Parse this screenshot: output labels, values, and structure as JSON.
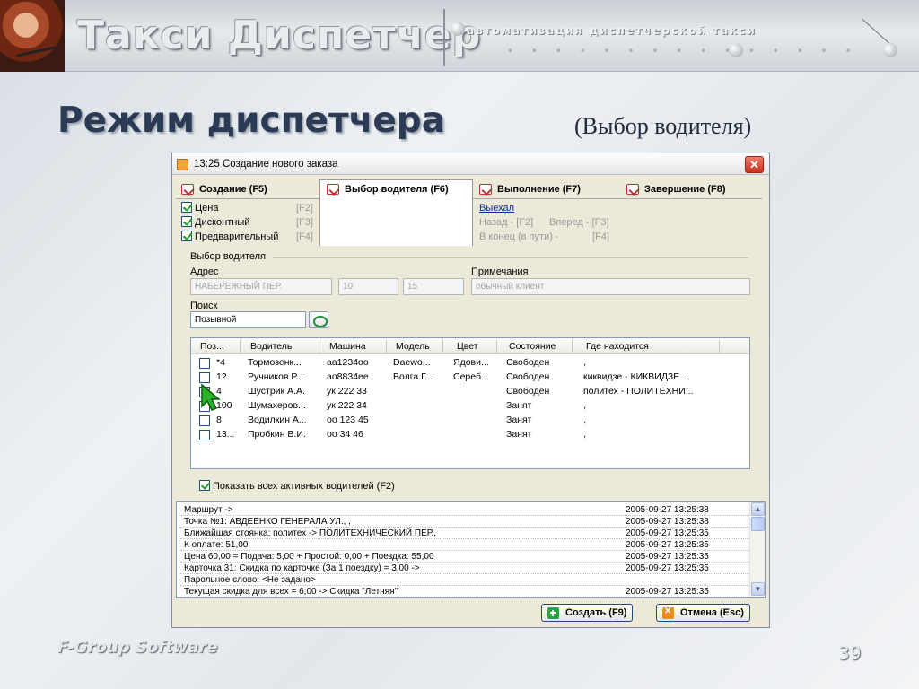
{
  "banner": {
    "title": "Такси Диспетчер",
    "subtitle": "автоматизация диспетчерской такси"
  },
  "slide": {
    "heading": "Режим диспетчера",
    "subheading": "(Выбор водителя)",
    "footer_company": "F-Group Software",
    "page_number": "39"
  },
  "window": {
    "title": "13:25 Создание нового заказа",
    "close_label": "✕",
    "tabs": [
      {
        "label": "Создание (F5)"
      },
      {
        "label": "Выбор водителя (F6)"
      },
      {
        "label": "Выполнение (F7)"
      },
      {
        "label": "Завершение (F8)"
      }
    ],
    "creation_options": [
      {
        "label": "Цена",
        "key": "[F2]",
        "checked": true
      },
      {
        "label": "Дисконтный",
        "key": "[F3]",
        "checked": true
      },
      {
        "label": "Предварительный",
        "key": "[F4]",
        "checked": true
      }
    ],
    "execution": {
      "link": "Выехал",
      "back": "Назад - [F2]",
      "forward": "Вперед - [F3]",
      "end": "В конец (в пути) -",
      "end_key": "[F4]"
    },
    "section_title": "Выбор водителя",
    "address_label": "Адрес",
    "address_value": "НАБЕРЕЖНЫЙ ПЕР.",
    "house_value": "10",
    "apt_value": "15",
    "notes_label": "Примечания",
    "notes_value": "обычный клиент",
    "search_label": "Поиск",
    "search_value": "Позывной",
    "grid": {
      "columns": [
        "Поз...",
        "Водитель",
        "Машина",
        "Модель",
        "Цвет",
        "Состояние",
        "Где находится"
      ],
      "rows": [
        {
          "checked": false,
          "pos": "*4",
          "driver": "Тормозенк...",
          "car": "аа1234оо",
          "model": "Daewo...",
          "color": "Ядови...",
          "state": "Свободен",
          "location": ","
        },
        {
          "checked": false,
          "pos": "12",
          "driver": "Ручников Р...",
          "car": "ао8834ее",
          "model": "Волга Г...",
          "color": "Сереб...",
          "state": "Свободен",
          "location": "киквидзе - КИКВИДЗЕ ..."
        },
        {
          "checked": true,
          "pos": "4",
          "driver": "Шустрик А.А.",
          "car": "ук 222 33",
          "model": "",
          "color": "",
          "state": "Свободен",
          "location": "политех - ПОЛИТЕХНИ..."
        },
        {
          "checked": false,
          "pos": "100",
          "driver": "Шумахеров...",
          "car": "ук 222 34",
          "model": "",
          "color": "",
          "state": "Занят",
          "location": ","
        },
        {
          "checked": false,
          "pos": "8",
          "driver": "Водилкин А...",
          "car": "оо 123 45",
          "model": "",
          "color": "",
          "state": "Занят",
          "location": ","
        },
        {
          "checked": false,
          "pos": "13...",
          "driver": "Пробкин В.И.",
          "car": "оо 34 46",
          "model": "",
          "color": "",
          "state": "Занят",
          "location": ","
        }
      ]
    },
    "show_all_label": "Показать всех активных водителей (F2)",
    "show_all_checked": true,
    "log": [
      {
        "msg": "Маршрут ->",
        "time": "2005-09-27 13:25:38"
      },
      {
        "msg": "Точка №1: АВДЕЕНКО ГЕНЕРАЛА УЛ., ,",
        "time": "2005-09-27 13:25:38"
      },
      {
        "msg": "Ближайшая стоянка: политех -> ПОЛИТЕХНИЧЕСКИЙ ПЕР.,",
        "time": "2005-09-27 13:25:35"
      },
      {
        "msg": "К оплате: 51,00",
        "time": "2005-09-27 13:25:35"
      },
      {
        "msg": "Цена 60,00 = Подача: 5,00 + Простой: 0,00 + Поездка: 55,00",
        "time": "2005-09-27 13:25:35"
      },
      {
        "msg": "Карточка 31: Скидка по карточке (За 1 поездку) = 3,00 ->",
        "time": "2005-09-27 13:25:35"
      },
      {
        "msg": "Парольное слово: <Не задано>",
        "time": ""
      },
      {
        "msg": "Текущая скидка для всех = 6,00 -> Скидка \"Летняя\"",
        "time": "2005-09-27 13:25:35"
      }
    ],
    "create_button": "Создать (F9)",
    "cancel_button": "Отмена (Esc)"
  },
  "colors": {
    "heading": "#2b3a55",
    "check": "#21a121",
    "tab_icon": "#c03030",
    "link": "#0b2aa8"
  }
}
